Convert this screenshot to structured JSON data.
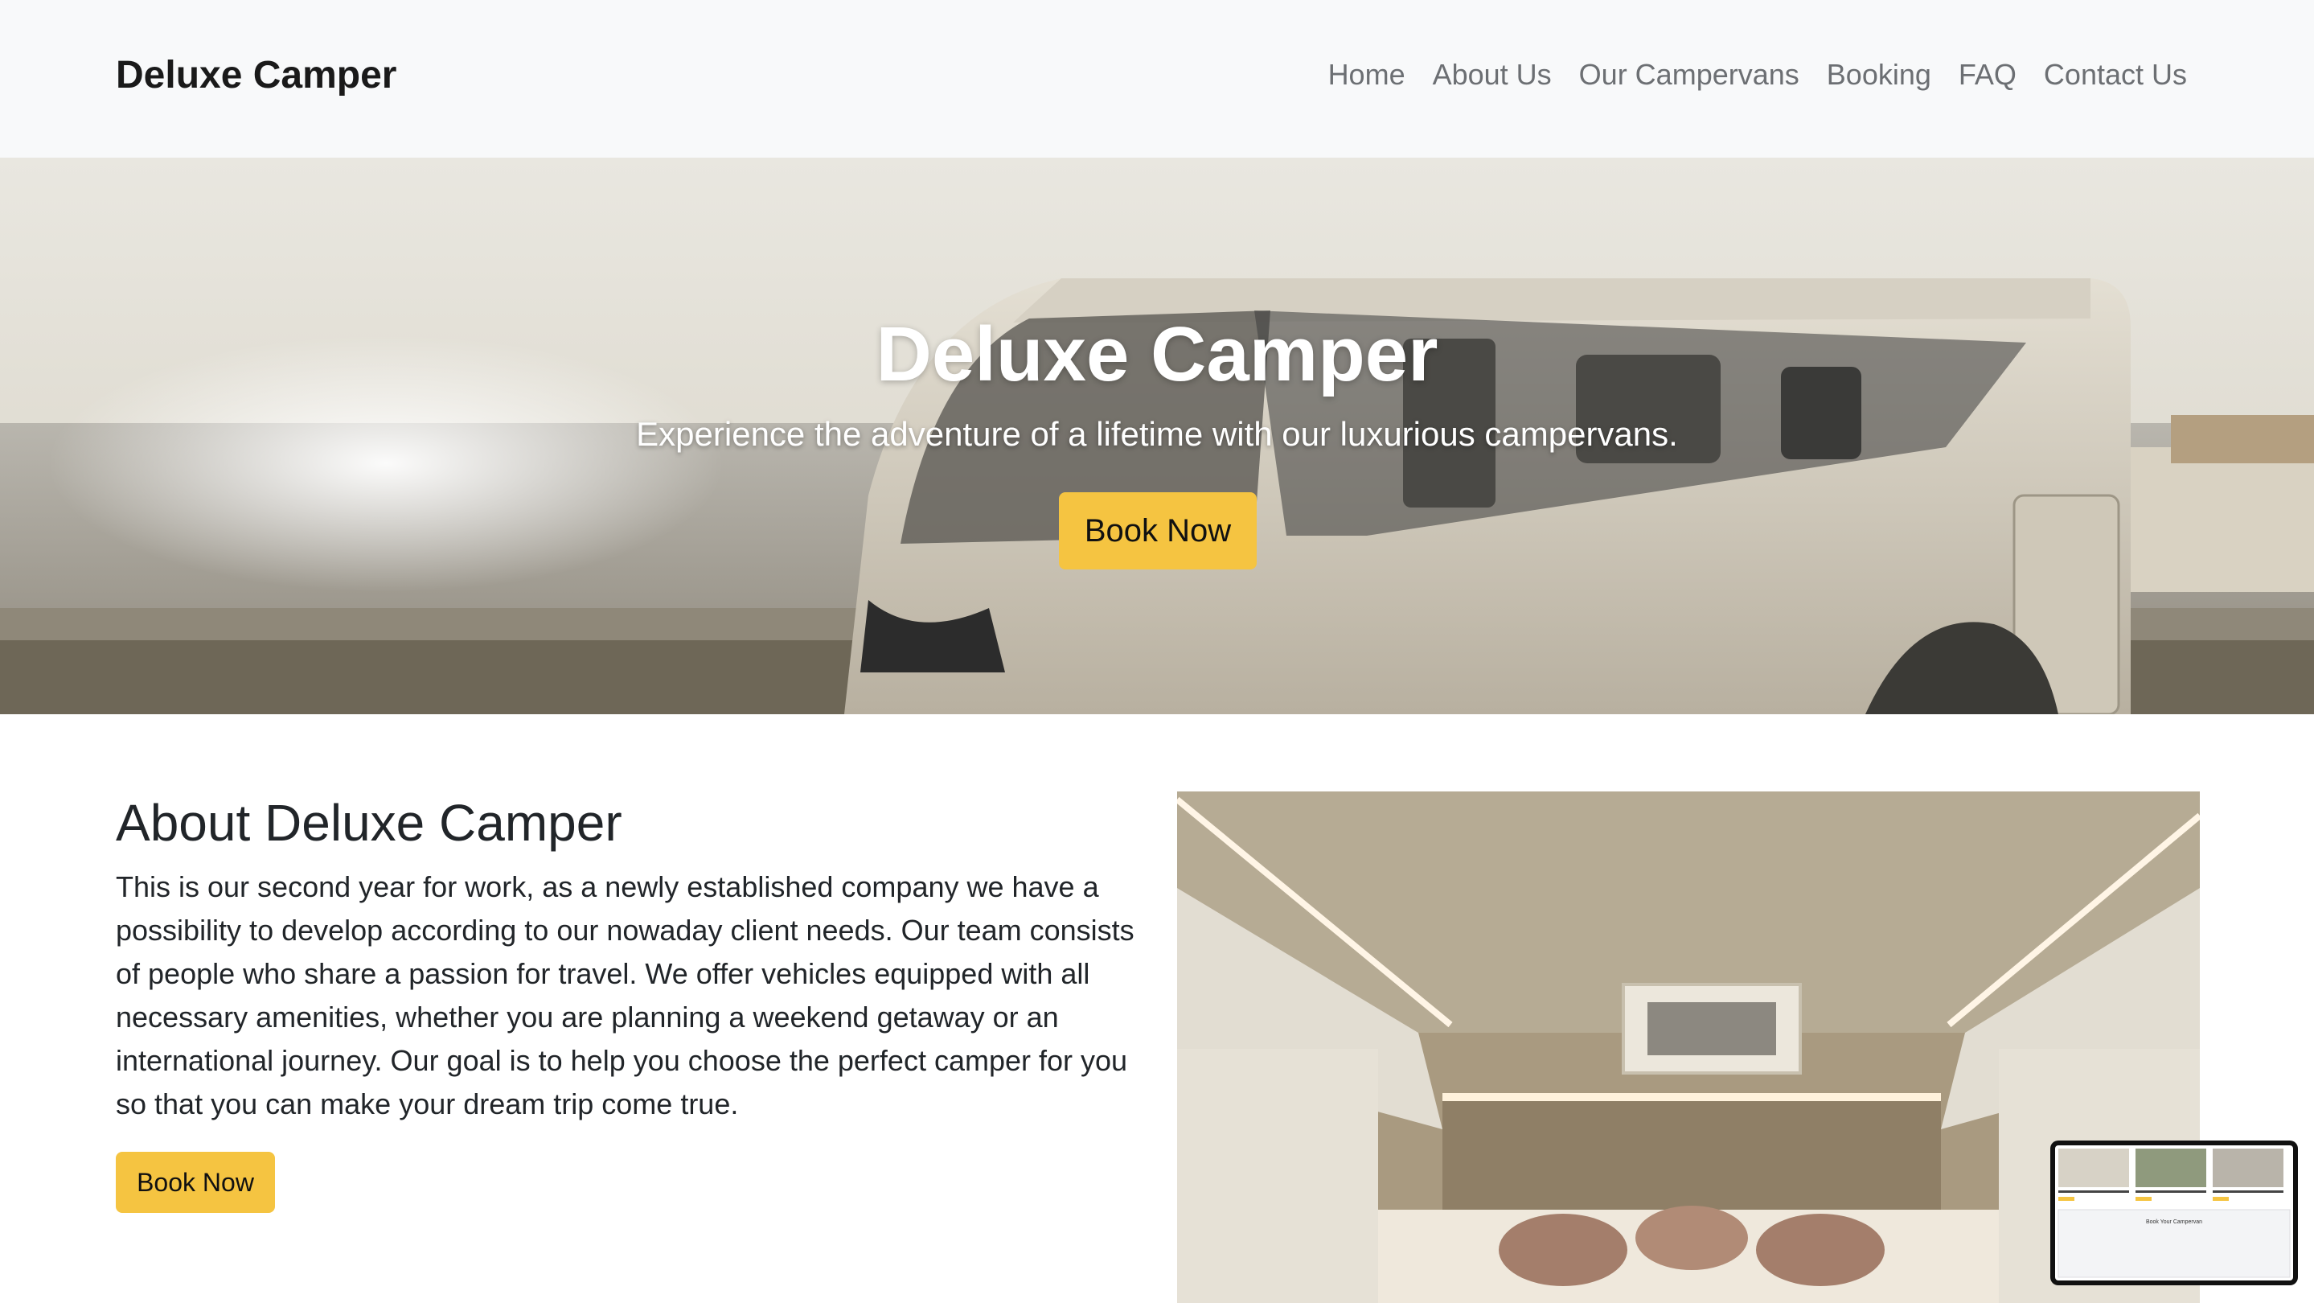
{
  "navbar": {
    "brand": "Deluxe Camper",
    "links": [
      "Home",
      "About Us",
      "Our Campervans",
      "Booking",
      "FAQ",
      "Contact Us"
    ]
  },
  "hero": {
    "title": "Deluxe Camper",
    "subtitle": "Experience the adventure of a lifetime with our luxurious campervans.",
    "button": "Book Now"
  },
  "about": {
    "heading": "About Deluxe Camper",
    "text": "This is our second year for work, as a newly established company we have a possibility to develop according to our nowaday client needs. Our team consists of people who share a passion for travel. We offer vehicles equipped with all necessary amenities, whether you are planning a weekend getaway or an international journey. Our goal is to help you choose the perfect camper for you so that you can make your dream trip come true.",
    "button": "Book Now"
  },
  "thumbnail": {
    "section_title": "Book Your Campervan"
  },
  "colors": {
    "accent": "#f5c441",
    "navbar_bg": "#f8f9fa",
    "nav_text": "#6c6f73"
  }
}
